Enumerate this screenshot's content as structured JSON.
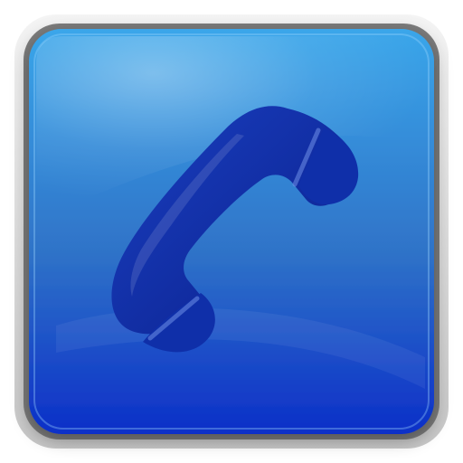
{
  "icon": {
    "name": "phone-app-icon",
    "glyph": "telephone-handset-icon"
  },
  "colors": {
    "tile_top": "#3aa6ea",
    "tile_mid": "#2f73c8",
    "tile_bottom": "#0c2fc8",
    "bezel_outer": "#e8e8e8",
    "bezel_inner": "#7d7d7d",
    "handset": "#0f2fa9",
    "handset_shadow": "#0b2386",
    "gloss": "#ffffff"
  }
}
